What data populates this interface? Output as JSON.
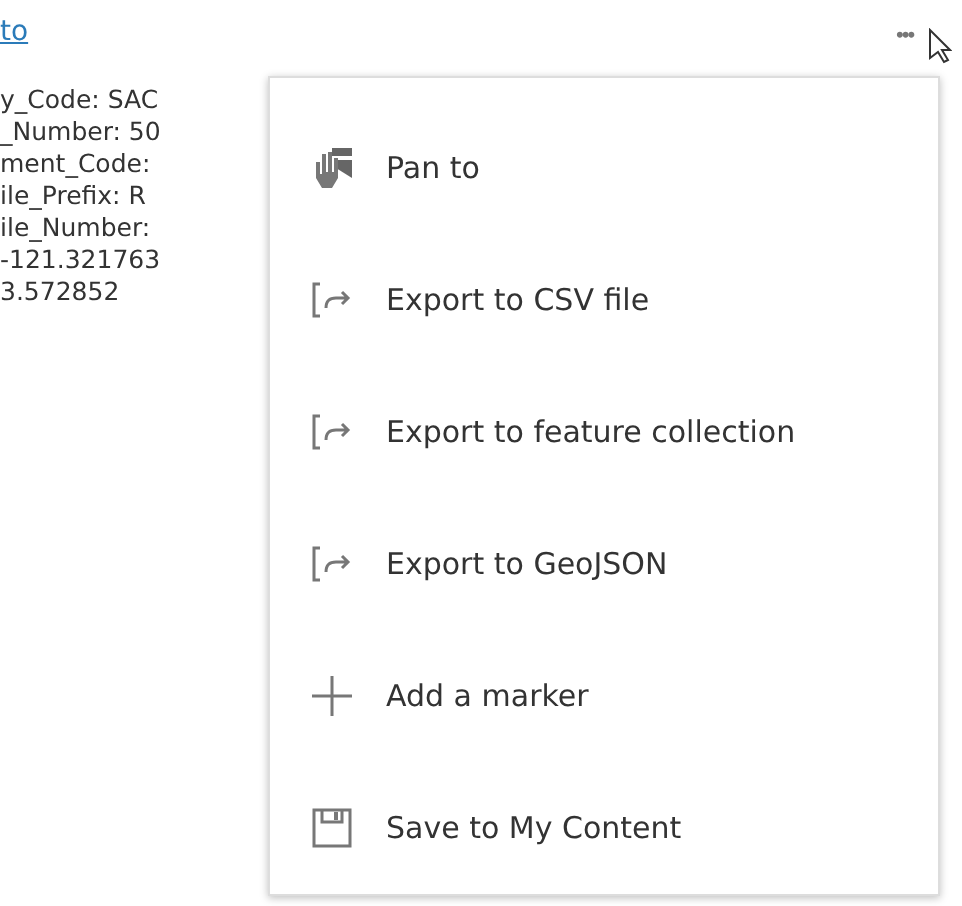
{
  "link": "to",
  "attributes": [
    "y_Code: SAC",
    "_Number: 50",
    "ment_Code:",
    "ile_Prefix: R",
    "ile_Number:",
    "-121.321763",
    "3.572852"
  ],
  "more_button": "•••",
  "menu": [
    {
      "label": "Pan to",
      "kind": "pan"
    },
    {
      "label": "Export to CSV file",
      "kind": "export"
    },
    {
      "label": "Export to feature collection",
      "kind": "export"
    },
    {
      "label": "Export to GeoJSON",
      "kind": "export"
    },
    {
      "label": "Add a marker",
      "kind": "plus"
    },
    {
      "label": "Save to My Content",
      "kind": "save"
    }
  ]
}
